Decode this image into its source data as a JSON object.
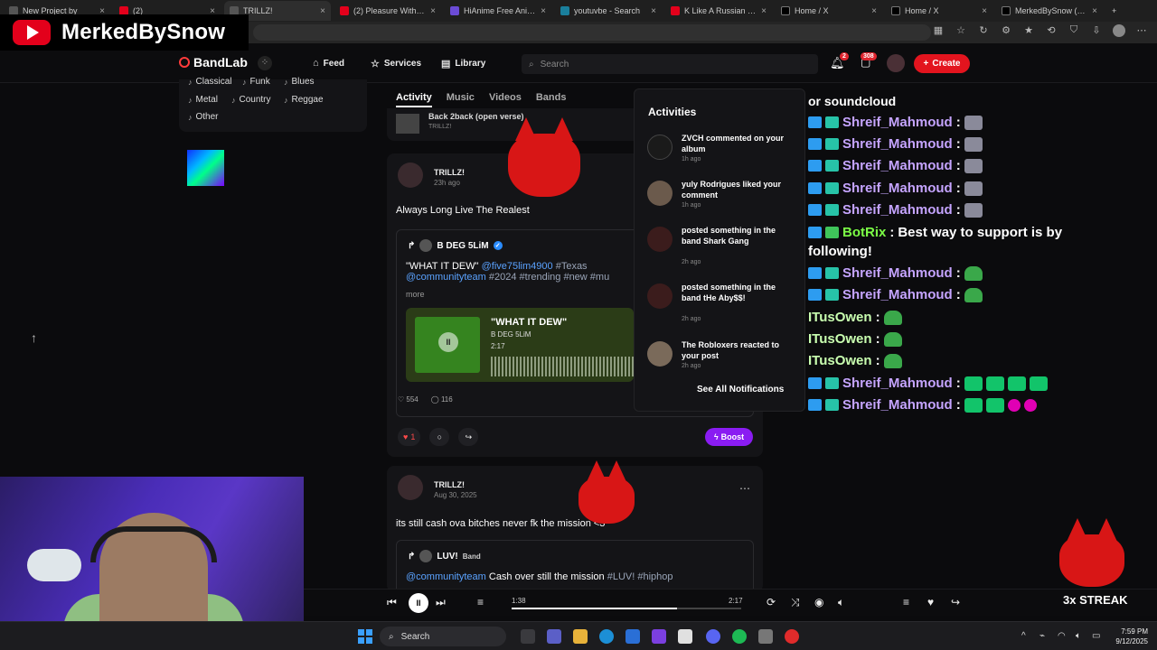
{
  "browser": {
    "tabs": [
      {
        "title": "New Project by",
        "icon": "bandlab-icon"
      },
      {
        "title": "(2)",
        "icon": "youtube-icon"
      },
      {
        "title": "TRILLZ!",
        "icon": "bandlab-icon"
      },
      {
        "title": "(2) Pleasure With The P",
        "icon": "youtube-icon"
      },
      {
        "title": "HiAnime Free Anime St",
        "icon": "anime-icon"
      },
      {
        "title": "youtuvbe - Search",
        "icon": "bing-icon"
      },
      {
        "title": "K Like A Russian - YouT",
        "icon": "youtube-icon"
      },
      {
        "title": "Home / X",
        "icon": "x-icon"
      },
      {
        "title": "Home / X",
        "icon": "x-icon"
      },
      {
        "title": "MerkedBySnow (@Me",
        "icon": "x-icon"
      }
    ],
    "new_tab": "+"
  },
  "overlay": {
    "channel_name": "MerkedBySnow"
  },
  "nav": {
    "logo": "BandLab",
    "feed": "Feed",
    "services": "Services",
    "library": "Library",
    "search_placeholder": "Search",
    "notif_count": "2",
    "msg_count": "308",
    "create": "Create"
  },
  "genres": {
    "row1": [
      "Classical",
      "Funk",
      "Blues"
    ],
    "row2": [
      "Metal",
      "Country",
      "Reggae"
    ],
    "row3": [
      "Other"
    ]
  },
  "feed_tabs": [
    "Activity",
    "Music",
    "Videos",
    "Bands"
  ],
  "prev_post": {
    "title": "Back 2back (open verse)",
    "author": "TRILLZ!"
  },
  "post1": {
    "author": "TRILLZ!",
    "time": "23h ago",
    "text": "Always Long Live The Realest",
    "quote_author": "B DEG 5LiM",
    "quote_title": "\"WHAT IT DEW\"",
    "quote_mention": "@five75lim4900",
    "quote_tags_line1": "#Texas",
    "quote_mention2": "@communityteam",
    "quote_tags_line2": "#2024 #trending #new #mu",
    "more": "more",
    "track_title": "\"WHAT IT DEW\"",
    "track_artist": "B DEG 5LiM",
    "track_duration": "2:17",
    "likes": "554",
    "comments": "116",
    "like_count": "1",
    "boost": "Boost"
  },
  "post2": {
    "author": "TRILLZ!",
    "time": "Aug 30, 2025",
    "text": "its still cash ova bitches never fk the mission <3",
    "quote_author": "LUV!",
    "quote_band": "Band",
    "quote_mention": "@communityteam",
    "quote_text": "Cash over",
    "quote_text2": "still the mission",
    "quote_tags": "#LUV! #hiphop"
  },
  "notifications": {
    "title": "Activities",
    "items": [
      {
        "text": "ZVCH commented on your album",
        "time": "1h ago"
      },
      {
        "text": "yuly Rodrigues liked your comment",
        "time": "1h ago"
      },
      {
        "text": "posted something in the band Shark Gang",
        "time": "2h ago"
      },
      {
        "text": "posted something in the band tHe Aby$$!",
        "time": "2h ago"
      },
      {
        "text": "The Robloxers reacted to your post",
        "time": "2h ago"
      }
    ],
    "see_all": "See All Notifications"
  },
  "chat": {
    "header": "or soundcloud",
    "lines": [
      {
        "user": "Shreif_Mahmoud",
        "msg": ""
      },
      {
        "user": "Shreif_Mahmoud",
        "msg": ""
      },
      {
        "user": "Shreif_Mahmoud",
        "msg": ""
      },
      {
        "user": "Shreif_Mahmoud",
        "msg": ""
      },
      {
        "user": "Shreif_Mahmoud",
        "msg": ""
      },
      {
        "user": "BotRix",
        "msg": "Best way to support is by"
      },
      {
        "user": "",
        "msg": "following!"
      },
      {
        "user": "Shreif_Mahmoud",
        "msg": ""
      },
      {
        "user": "Shreif_Mahmoud",
        "msg": ""
      },
      {
        "user": "ITusOwen",
        "msg": ""
      },
      {
        "user": "ITusOwen",
        "msg": ""
      },
      {
        "user": "ITusOwen",
        "msg": ""
      },
      {
        "user": "Shreif_Mahmoud",
        "msg": ""
      },
      {
        "user": "Shreif_Mahmoud",
        "msg": ""
      }
    ]
  },
  "player": {
    "current": "1:38",
    "total": "2:17",
    "progress": 0.72
  },
  "streak": "3x STREAK",
  "taskbar": {
    "search": "Search",
    "time": "7:59 PM",
    "date": "9/12/2025"
  }
}
